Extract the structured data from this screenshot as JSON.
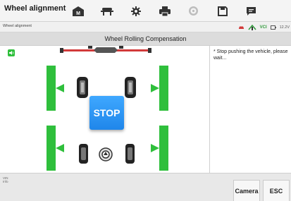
{
  "header": {
    "app_title": "Wheel alignment",
    "tools": [
      {
        "icon": "garage-icon",
        "label": "Home"
      },
      {
        "icon": "car-lift-icon",
        "label": "Vehicle"
      },
      {
        "icon": "gear-icon",
        "label": "Settings"
      },
      {
        "icon": "printer-icon",
        "label": "Print"
      },
      {
        "icon": "steering-wheel-icon",
        "label": "Steering"
      },
      {
        "icon": "save-icon",
        "label": "Save"
      },
      {
        "icon": "chat-icon",
        "label": "Message"
      }
    ]
  },
  "subbar": {
    "breadcrumb": "Wheel alignment",
    "vci": "VCI",
    "voltage": "12.2V"
  },
  "panel": {
    "title": "Wheel Rolling Compensation",
    "stop_label": "STOP",
    "message": "* Stop pushing the vehicle, please wait..."
  },
  "footer": {
    "vin_label": "VIN",
    "info_label": "Info",
    "buttons": {
      "camera": "Camera",
      "esc": "ESC"
    }
  },
  "colors": {
    "accent_green": "#2fbf3c",
    "stop_blue": "#1f86ea"
  }
}
